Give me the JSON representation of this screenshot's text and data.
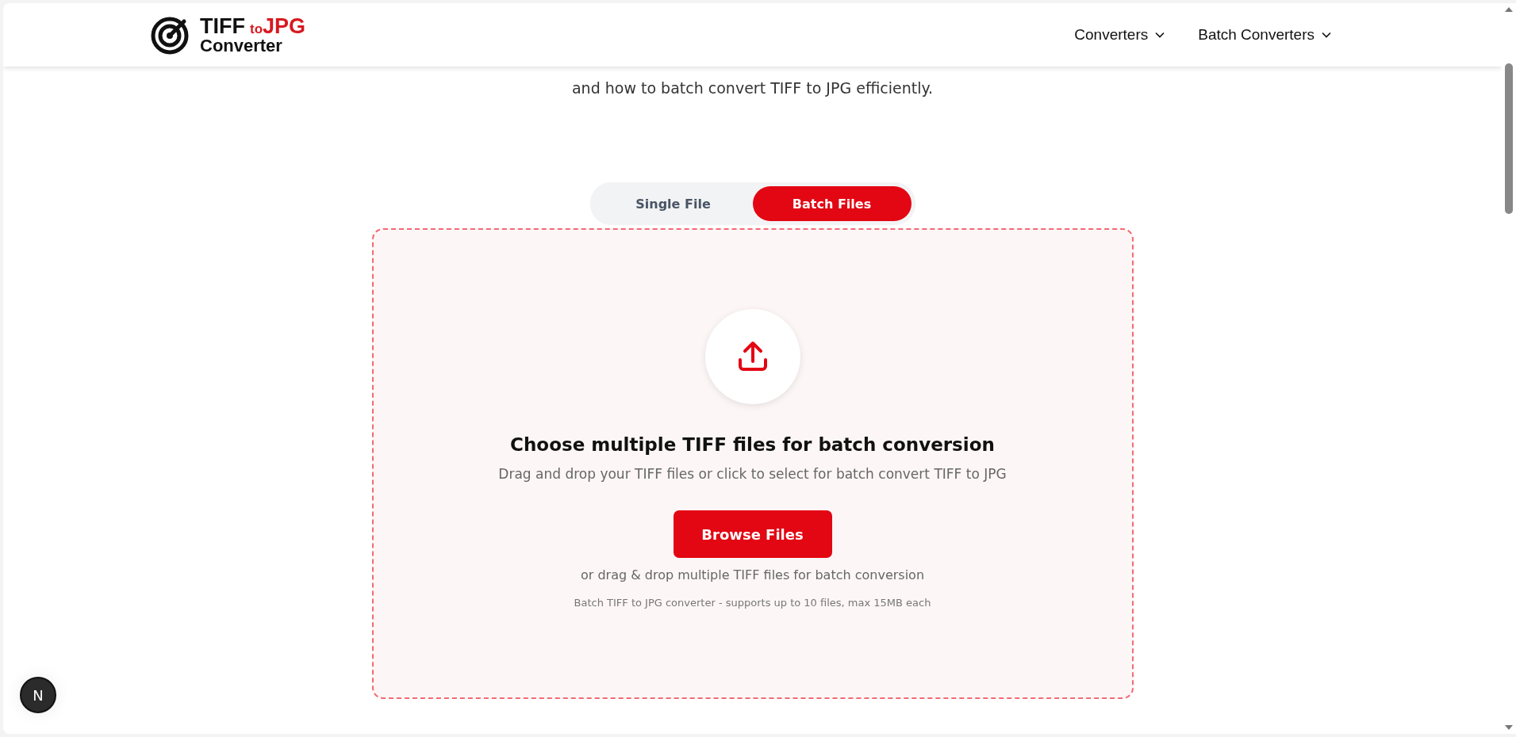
{
  "header": {
    "logo": {
      "word1": "TIFF",
      "word2": "to",
      "word3": "JPG",
      "word4": "Converter"
    },
    "nav": [
      {
        "label": "Converters"
      },
      {
        "label": "Batch Converters"
      }
    ]
  },
  "intro": "and how to batch convert TIFF to JPG efficiently.",
  "tabs": [
    {
      "label": "Single File",
      "selected": false
    },
    {
      "label": "Batch Files",
      "selected": true
    }
  ],
  "dropzone": {
    "title": "Choose multiple TIFF files for batch conversion",
    "subtitle": "Drag and drop your TIFF files or click to select for batch convert TIFF to JPG",
    "button": "Browse Files",
    "hint": "or drag & drop multiple TIFF files for batch conversion",
    "note": "Batch TIFF to JPG converter - supports up to 10 files, max 15MB each"
  },
  "dev_badge": "N"
}
